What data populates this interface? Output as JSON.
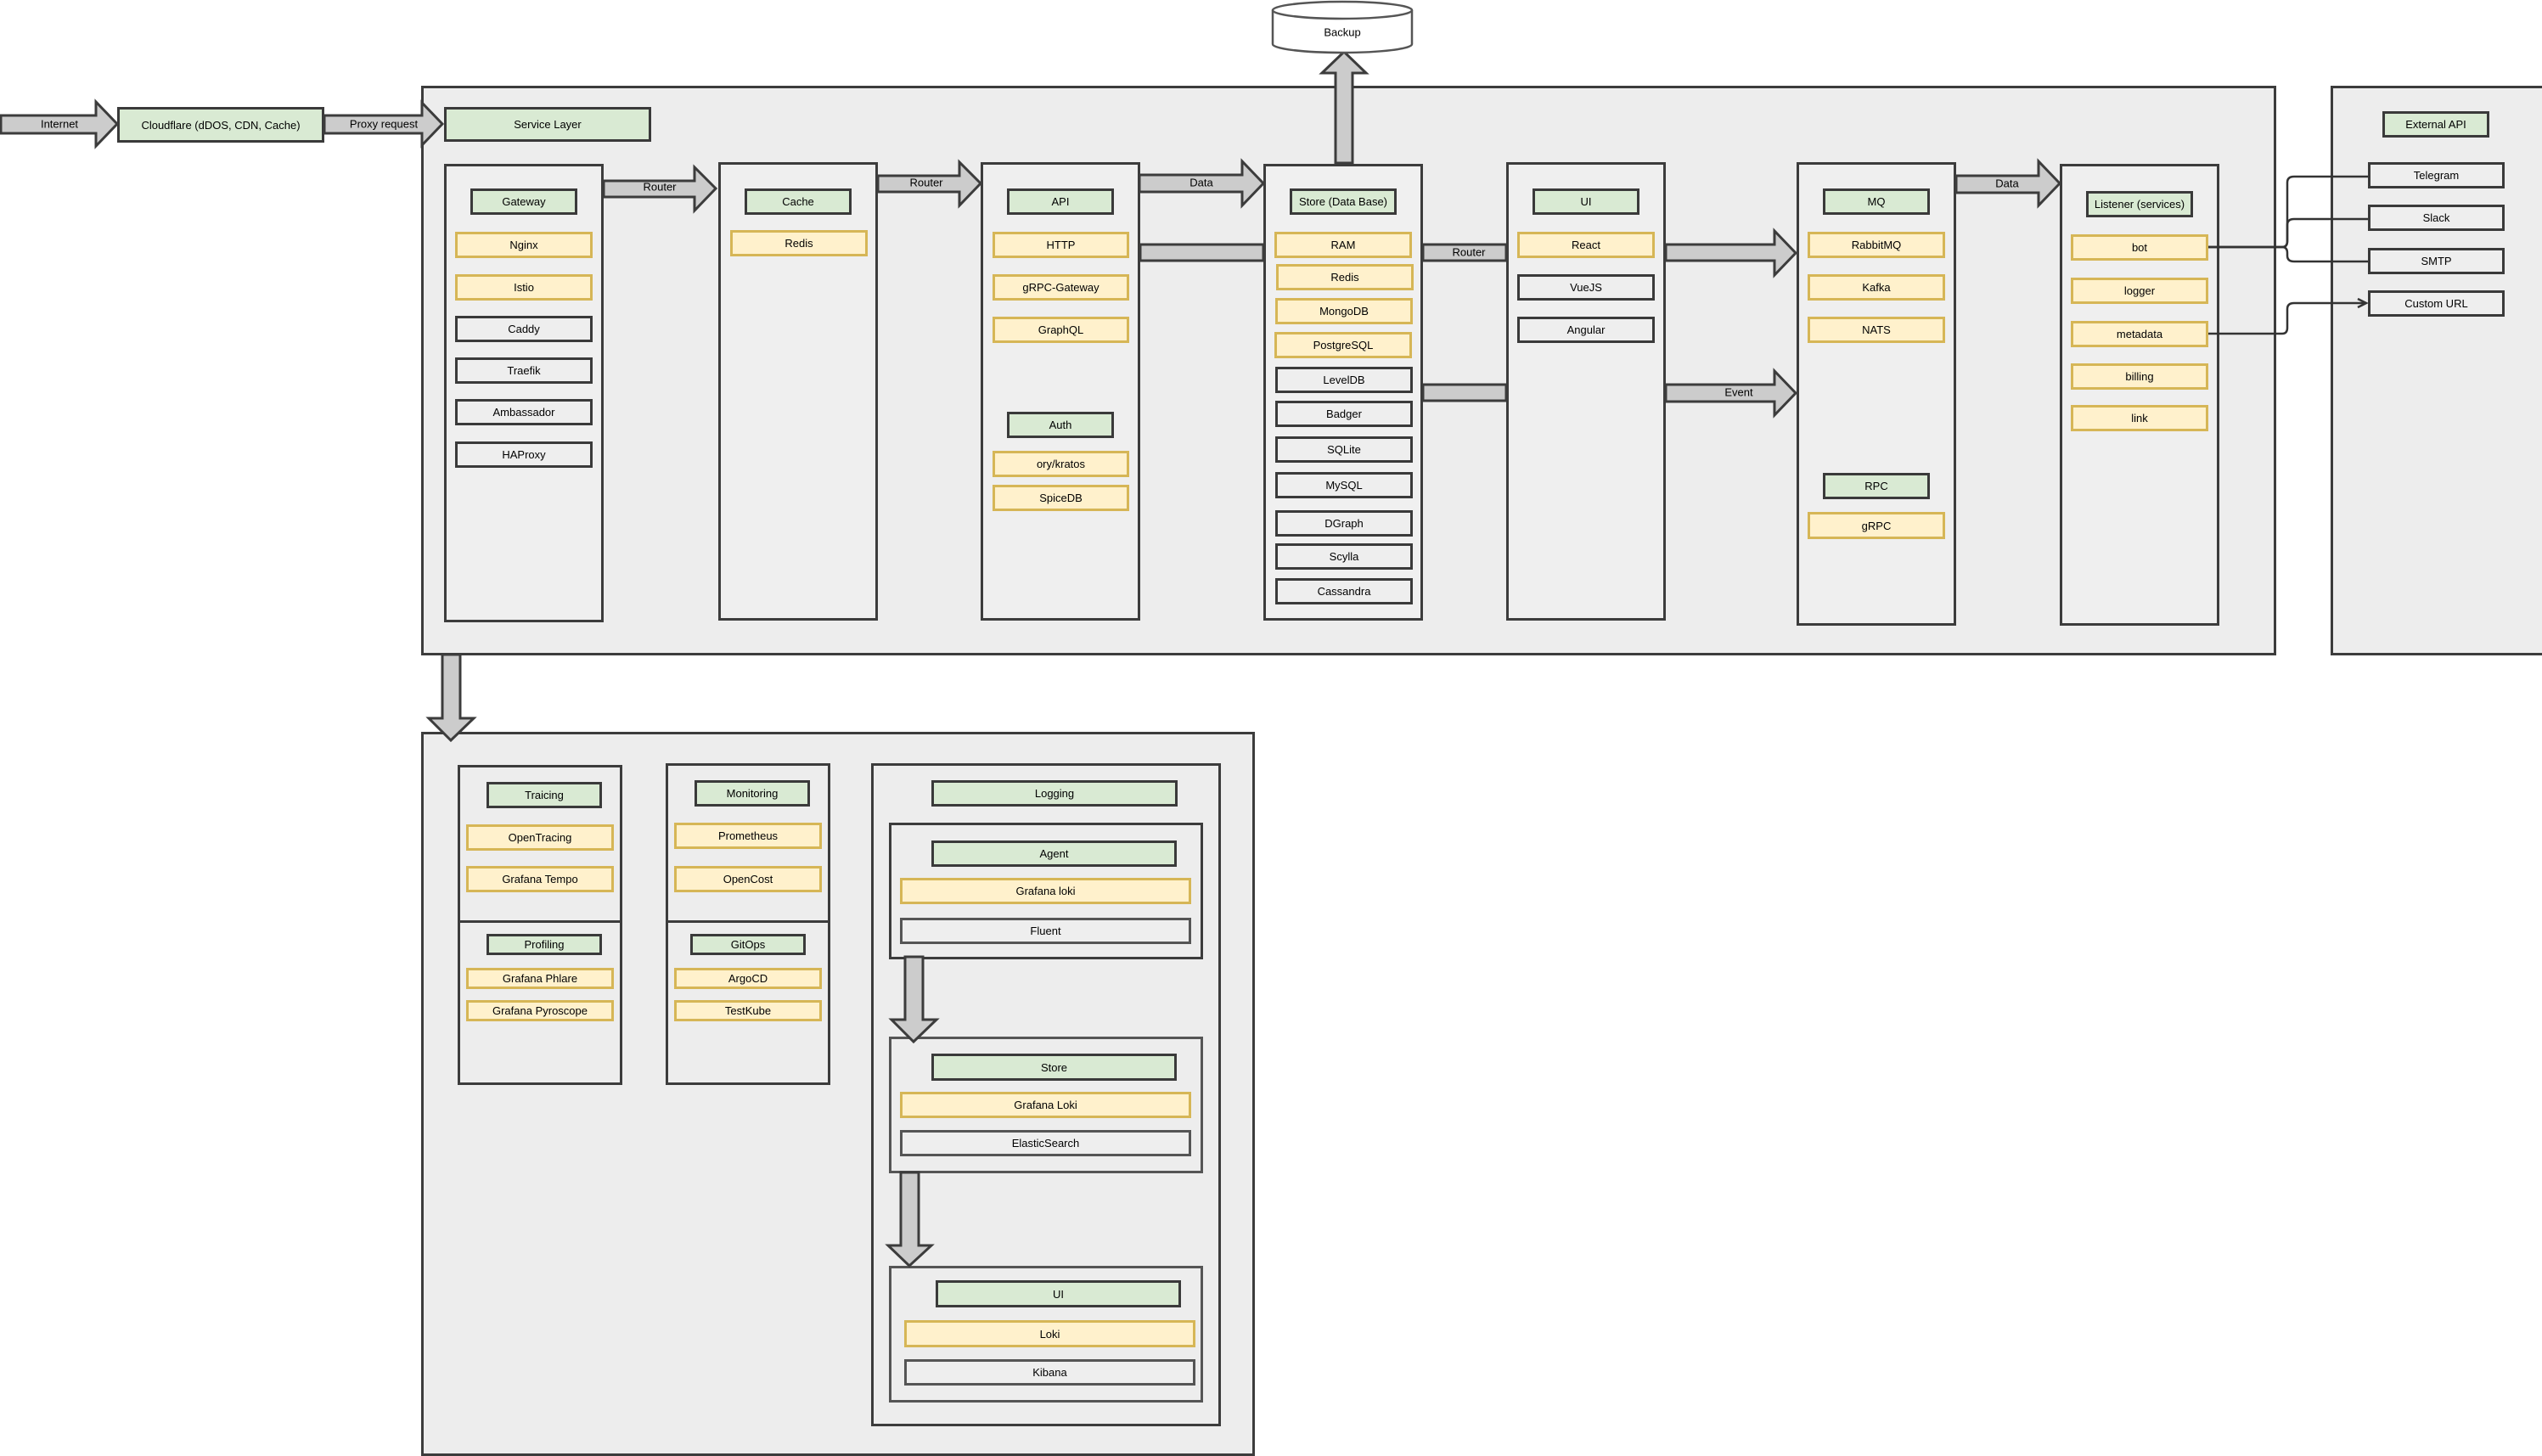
{
  "edge": {
    "internet_label": "Internet",
    "cloudflare_label": "Cloudflare (dDOS, CDN, Cache)",
    "proxy_label": "Proxy request"
  },
  "backup": {
    "label": "Backup"
  },
  "service_layer": {
    "title": "Service Layer",
    "gateway": {
      "title": "Gateway",
      "items": [
        "Nginx",
        "Istio",
        "Caddy",
        "Traefik",
        "Ambassador",
        "HAProxy"
      ]
    },
    "cache": {
      "title": "Cache",
      "items": [
        "Redis"
      ]
    },
    "api": {
      "title": "API",
      "items": [
        "HTTP",
        "gRPC-Gateway",
        "GraphQL"
      ]
    },
    "auth": {
      "title": "Auth",
      "items": [
        "ory/kratos",
        "SpiceDB"
      ]
    },
    "store": {
      "title": "Store (Data Base)",
      "items": [
        "RAM",
        "Redis",
        "MongoDB",
        "PostgreSQL",
        "LevelDB",
        "Badger",
        "SQLite",
        "MySQL",
        "DGraph",
        "Scylla",
        "Cassandra"
      ]
    },
    "ui": {
      "title": "UI",
      "items": [
        "React",
        "VueJS",
        "Angular"
      ]
    },
    "mq": {
      "title": "MQ",
      "items": [
        "RabbitMQ",
        "Kafka",
        "NATS"
      ]
    },
    "rpc": {
      "title": "RPC",
      "items": [
        "gRPC"
      ]
    },
    "listener": {
      "title": "Listener (services)",
      "items": [
        "bot",
        "logger",
        "metadata",
        "billing",
        "link"
      ]
    }
  },
  "flows": {
    "gateway_to_cache": "Router",
    "cache_to_api": "Router",
    "api_to_store": "Data",
    "store_to_ui": "Router",
    "ui_to_mq_event": "Event",
    "mq_to_listener": "Data"
  },
  "external_api": {
    "title": "External API",
    "items": [
      "Telegram",
      "Slack",
      "SMTP",
      "Custom URL"
    ]
  },
  "observability": {
    "tracing": {
      "title": "Traicing",
      "items": [
        "OpenTracing",
        "Grafana Tempo"
      ]
    },
    "monitoring": {
      "title": "Monitoring",
      "items": [
        "Prometheus",
        "OpenCost"
      ]
    },
    "profiling": {
      "title": "Profiling",
      "items": [
        "Grafana Phlare",
        "Grafana Pyroscope"
      ]
    },
    "gitops": {
      "title": "GitOps",
      "items": [
        "ArgoCD",
        "TestKube"
      ]
    },
    "logging": {
      "title": "Logging",
      "agent": {
        "title": "Agent",
        "items": [
          "Grafana loki",
          "Fluent"
        ]
      },
      "store": {
        "title": "Store",
        "items": [
          "Grafana Loki",
          "ElasticSearch"
        ]
      },
      "ui": {
        "title": "UI",
        "items": [
          "Loki",
          "Kibana"
        ]
      }
    }
  },
  "colors": {
    "header_fill": "#d9ead3",
    "highlight_fill": "#fff1cc",
    "highlight_border": "#d6b656",
    "container_fill": "#ededed",
    "arrow_fill": "#cccccc"
  }
}
